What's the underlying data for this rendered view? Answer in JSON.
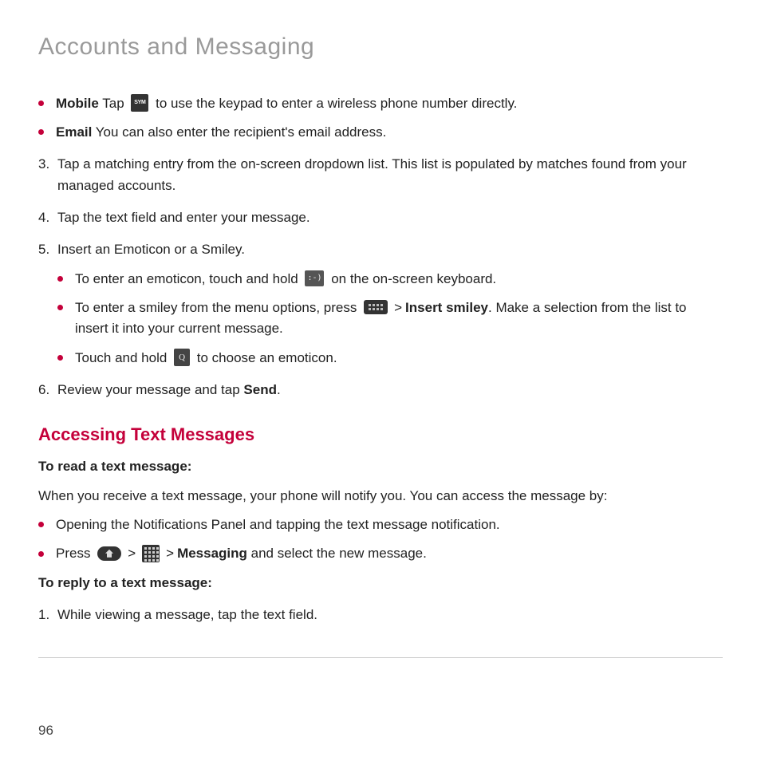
{
  "chapter_title": "Accounts and Messaging",
  "bullets_top": {
    "mobile": {
      "bold": "Mobile",
      "pre": " Tap ",
      "post": " to use the keypad to enter a wireless phone number directly."
    },
    "email": {
      "bold": "Email",
      "rest": " You can also enter the recipient's email address."
    }
  },
  "steps": {
    "s3": {
      "num": "3.",
      "text": "Tap a matching entry from the on-screen dropdown list. This list is populated by matches found from your managed accounts."
    },
    "s4": {
      "num": "4.",
      "text": "Tap the text field and enter your message."
    },
    "s5": {
      "num": "5.",
      "text": "Insert an Emoticon or a Smiley."
    },
    "s5_sub": {
      "a": {
        "pre": "To enter an emoticon, touch and hold ",
        "post": " on the on-screen keyboard."
      },
      "b": {
        "pre": "To enter a smiley from the menu options, press ",
        "gt": ">",
        "bold": "Insert smiley",
        "post": ". Make a selection from the list to insert it into your current message."
      },
      "c": {
        "pre": "Touch and hold ",
        "post": " to choose an emoticon."
      }
    },
    "s6": {
      "num": "6.",
      "pre": "Review your message and tap ",
      "bold": "Send",
      "post": "."
    }
  },
  "section2": {
    "heading": "Accessing Text Messages",
    "read_label": "To read a text message:",
    "read_intro": "When you receive a text message, your phone will notify you. You can access the message by:",
    "read_bullets": {
      "a": "Opening the Notifications Panel and tapping the text message notification.",
      "b": {
        "pre": "Press ",
        "gt1": ">",
        "gt2": ">",
        "bold": "Messaging",
        "post": " and select the new message."
      }
    },
    "reply_label": "To reply to a text message:",
    "reply_steps": {
      "r1": {
        "num": "1.",
        "text": "While viewing a message, tap the text field."
      }
    }
  },
  "page_number": "96",
  "icon_labels": {
    "sym": "SYM",
    "emoticon": ":-)",
    "q": "Q"
  }
}
